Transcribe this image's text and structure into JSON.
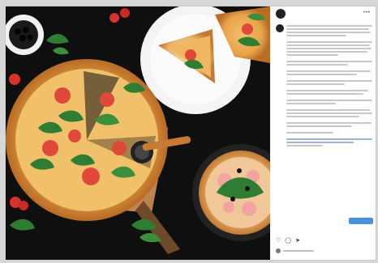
{
  "post": {
    "username": "",
    "more_icon": "ellipsis-icon",
    "caption_lines": 34,
    "translate_label": "",
    "follow_label": ""
  },
  "actions": {
    "icons": [
      "heart-icon",
      "comment-icon",
      "share-icon"
    ]
  },
  "colors": {
    "background": "#111111",
    "accent": "#4a90e2",
    "pizza_crust": "#e3a85a",
    "tomato": "#d9382b",
    "basil": "#2f7d32"
  }
}
